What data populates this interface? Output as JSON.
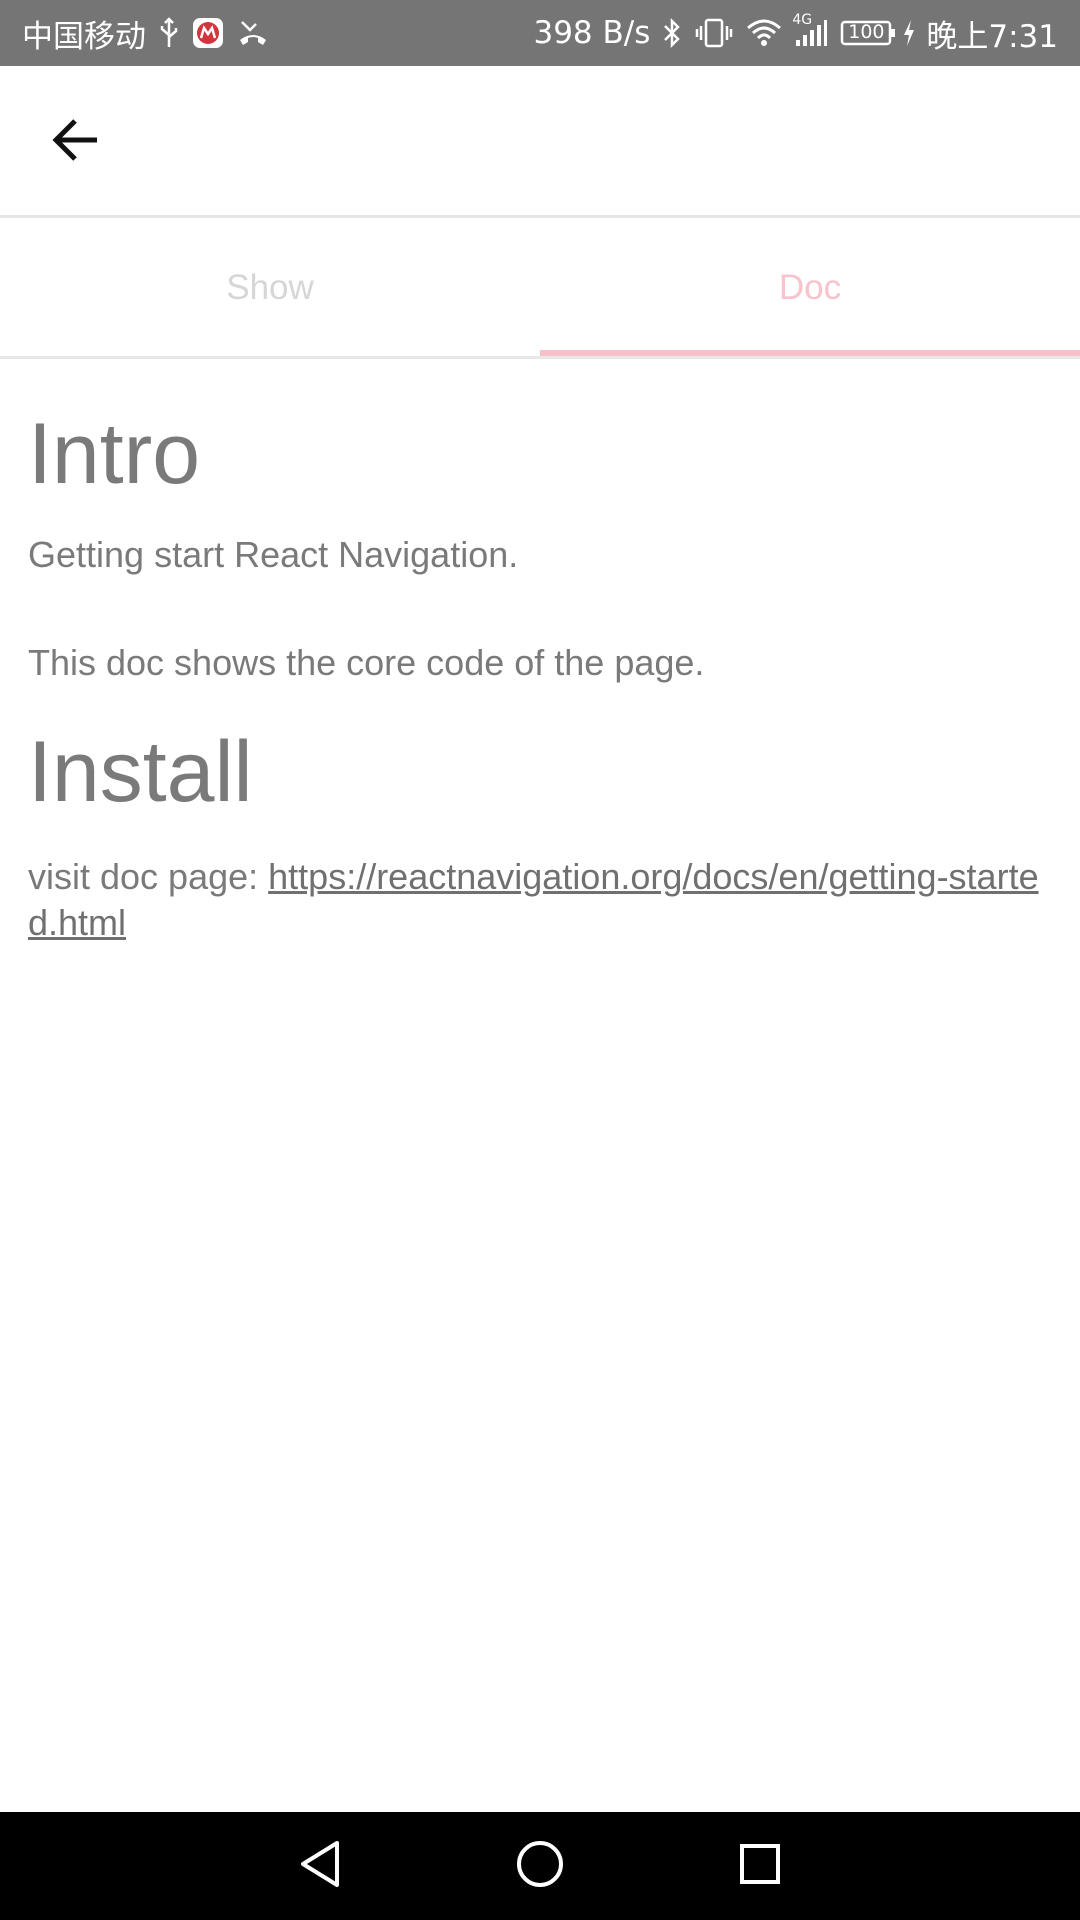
{
  "status_bar": {
    "carrier": "中国移动",
    "network_speed": "398 B/s",
    "signal_type": "4G",
    "battery": "100",
    "time": "晚上7:31",
    "icons": [
      "usb-icon",
      "app-notification-icon",
      "missed-call-icon",
      "bluetooth-icon",
      "vibrate-icon",
      "wifi-icon",
      "cellular-signal-icon",
      "battery-icon",
      "charging-icon"
    ]
  },
  "header": {
    "back_icon": "arrow-left-icon"
  },
  "tabs": [
    {
      "label": "Show",
      "active": false
    },
    {
      "label": "Doc",
      "active": true
    }
  ],
  "colors": {
    "active_tab": "#f8c3cc",
    "inactive_tab": "#d6d6d6",
    "body_text": "#7a7a7a",
    "status_bar": "#757575"
  },
  "doc": {
    "intro_heading": "Intro",
    "intro_text_1": "Getting start React Navigation.",
    "intro_text_2": "This doc shows the core code of the page.",
    "install_heading": "Install",
    "install_prefix": "visit doc page: ",
    "install_link": "https://reactnavigation.org/docs/en/getting-started.html"
  },
  "nav_bar": {
    "buttons": [
      "back-triangle-icon",
      "home-circle-icon",
      "recents-square-icon"
    ]
  }
}
